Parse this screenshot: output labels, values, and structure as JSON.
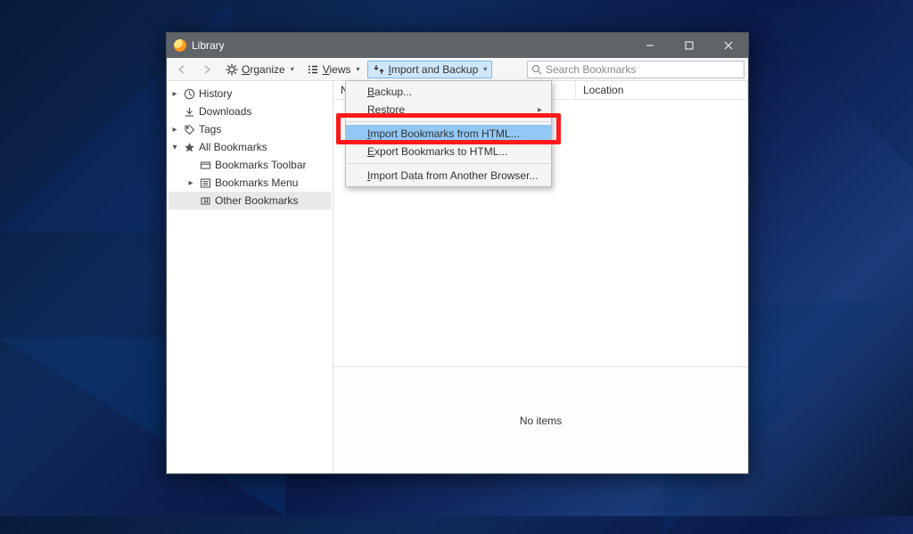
{
  "window": {
    "title": "Library"
  },
  "toolbar": {
    "organize": "Organize",
    "views": "Views",
    "import_backup": "Import and Backup"
  },
  "search": {
    "placeholder": "Search Bookmarks"
  },
  "columns": {
    "name": "N",
    "location": "Location"
  },
  "tree": {
    "history": "History",
    "downloads": "Downloads",
    "tags": "Tags",
    "all_bookmarks": "All Bookmarks",
    "toolbar": "Bookmarks Toolbar",
    "menu": "Bookmarks Menu",
    "other": "Other Bookmarks"
  },
  "detail": {
    "empty": "No items"
  },
  "menu": {
    "backup": "Backup...",
    "restore": "Restore",
    "import_html": "Import Bookmarks from HTML...",
    "export_html": "Export Bookmarks to HTML...",
    "import_browser": "Import Data from Another Browser..."
  }
}
